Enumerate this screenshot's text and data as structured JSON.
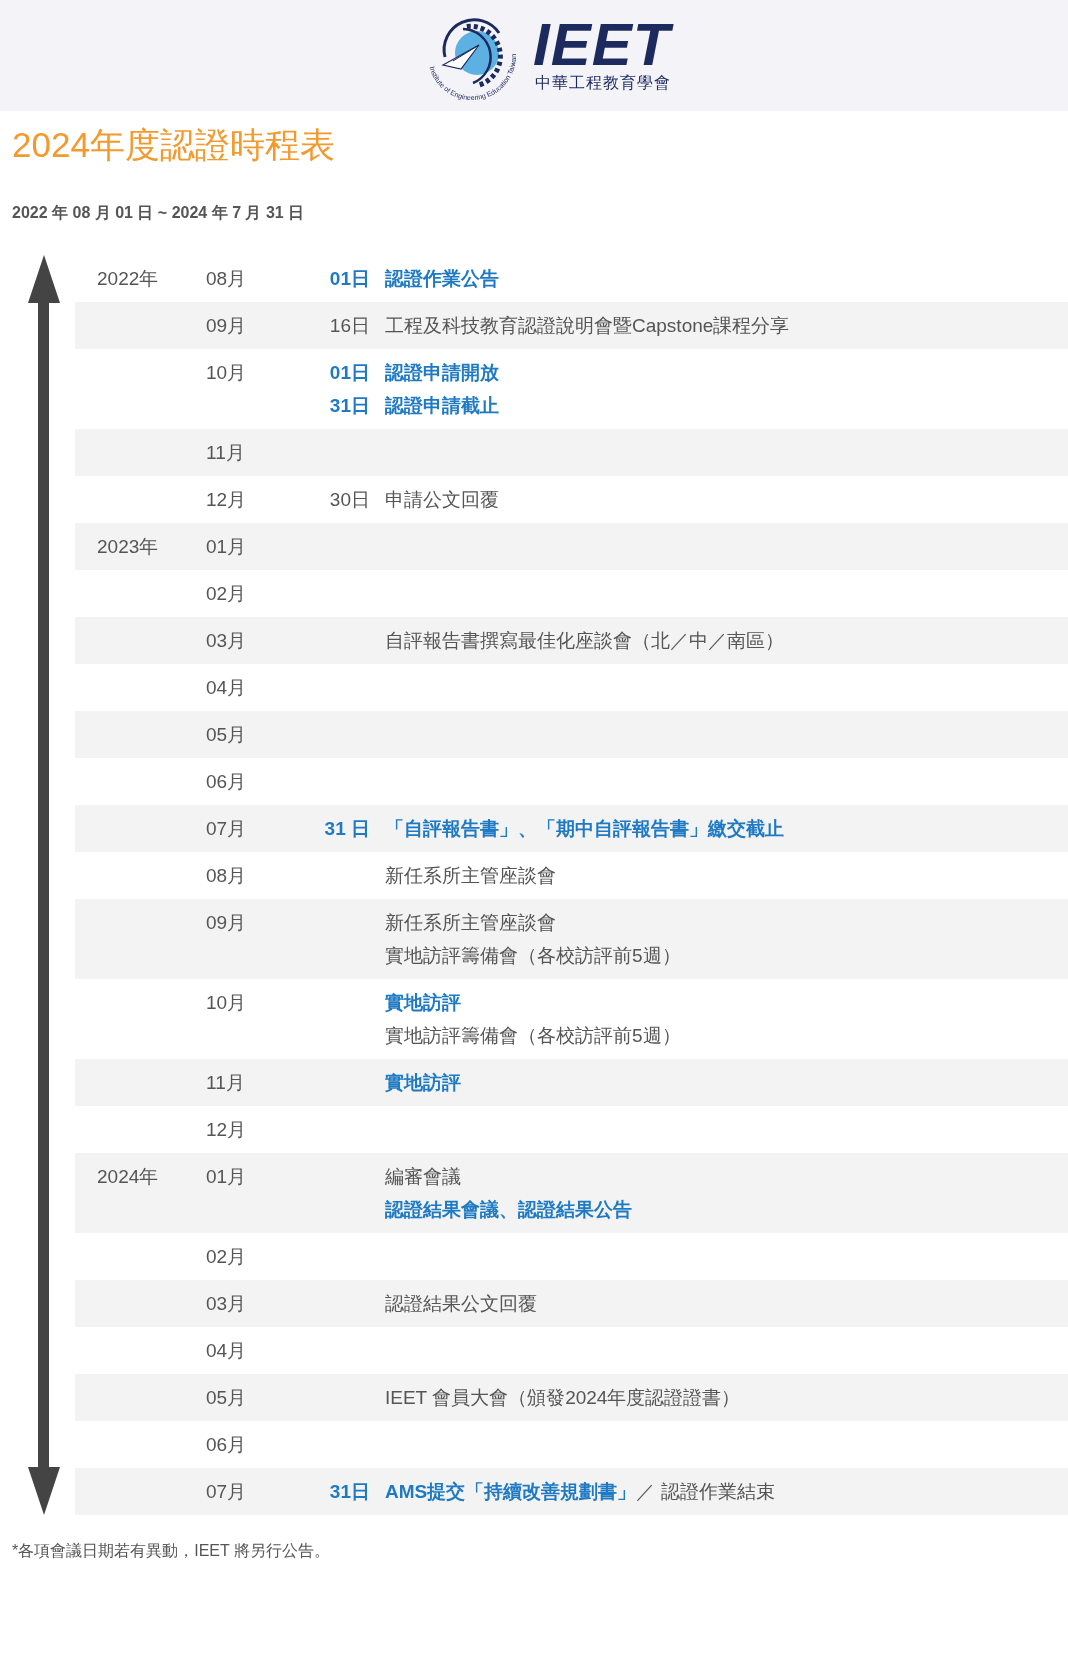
{
  "header": {
    "logo_arc_text": "Institute of Engineering Education Taiwan",
    "logo_wordmark": "IEET",
    "logo_subtitle": "中華工程教育學會"
  },
  "title": "2024年度認證時程表",
  "date_range": "2022 年 08 月 01 日 ~ 2024 年 7 月 31 日",
  "rows": [
    {
      "year": "2022年",
      "month": "08月",
      "events": [
        {
          "day": "01日",
          "day_highlight": true,
          "text": "認證作業公告",
          "highlight": true
        }
      ]
    },
    {
      "month": "09月",
      "events": [
        {
          "day": "16日",
          "day_highlight": false,
          "text": "工程及科技教育認證說明會暨Capstone課程分享",
          "highlight": false
        }
      ]
    },
    {
      "month": "10月",
      "events": [
        {
          "day": "01日",
          "day_highlight": true,
          "text": "認證申請開放",
          "highlight": true
        },
        {
          "day": "31日",
          "day_highlight": true,
          "text": "認證申請截止",
          "highlight": true
        }
      ]
    },
    {
      "month": "11月",
      "events": []
    },
    {
      "month": "12月",
      "events": [
        {
          "day": "30日",
          "day_highlight": false,
          "text": "申請公文回覆",
          "highlight": false
        }
      ]
    },
    {
      "year": "2023年",
      "month": "01月",
      "events": []
    },
    {
      "month": "02月",
      "events": []
    },
    {
      "month": "03月",
      "events": [
        {
          "text": "自評報告書撰寫最佳化座談會（北／中／南區）",
          "highlight": false
        }
      ]
    },
    {
      "month": "04月",
      "events": []
    },
    {
      "month": "05月",
      "events": []
    },
    {
      "month": "06月",
      "events": []
    },
    {
      "month": "07月",
      "events": [
        {
          "day": "31 日",
          "day_highlight": true,
          "text": "「自評報告書」、「期中自評報告書」繳交截止",
          "highlight": true
        }
      ]
    },
    {
      "month": "08月",
      "events": [
        {
          "text": "新任系所主管座談會",
          "highlight": false
        }
      ]
    },
    {
      "month": "09月",
      "events": [
        {
          "text": "新任系所主管座談會",
          "highlight": false
        },
        {
          "text": "實地訪評籌備會（各校訪評前5週）",
          "highlight": false
        }
      ]
    },
    {
      "month": "10月",
      "events": [
        {
          "text": "實地訪評",
          "highlight": true
        },
        {
          "text": "實地訪評籌備會（各校訪評前5週）",
          "highlight": false
        }
      ]
    },
    {
      "month": "11月",
      "events": [
        {
          "text": "實地訪評",
          "highlight": true
        }
      ]
    },
    {
      "month": "12月",
      "events": []
    },
    {
      "year": "2024年",
      "month": "01月",
      "events": [
        {
          "text": "編審會議",
          "highlight": false
        },
        {
          "text": "認證結果會議、認證結果公告",
          "highlight": true
        }
      ]
    },
    {
      "month": "02月",
      "events": []
    },
    {
      "month": "03月",
      "events": [
        {
          "text": "認證結果公文回覆",
          "highlight": false
        }
      ]
    },
    {
      "month": "04月",
      "events": []
    },
    {
      "month": "05月",
      "events": [
        {
          "text": "IEET 會員大會（頒發2024年度認證證書）",
          "highlight": false
        }
      ]
    },
    {
      "month": "06月",
      "events": []
    },
    {
      "month": "07月",
      "events": [
        {
          "day": "31日",
          "day_highlight": true,
          "text": "**AMS提交「持續改善規劃書」**／ 認證作業結束",
          "highlight": false
        }
      ]
    }
  ],
  "footnote": "*各項會議日期若有異動，IEET 將另行公告。"
}
